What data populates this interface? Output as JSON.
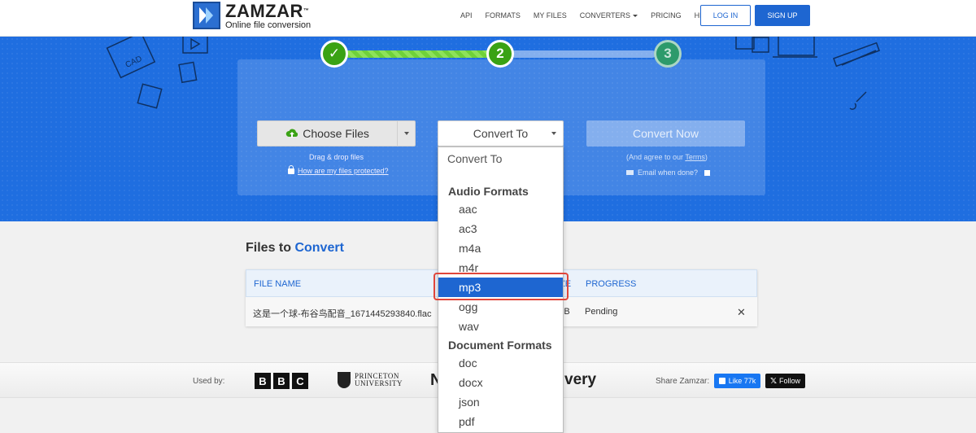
{
  "brand": {
    "name": "ZAMZAR",
    "tm": "™",
    "tagline": "Online file conversion"
  },
  "nav": {
    "links": [
      "API",
      "FORMATS",
      "MY FILES",
      "CONVERTERS",
      "PRICING",
      "HELP"
    ],
    "login": "LOG IN",
    "signup": "SIGN UP"
  },
  "steps": {
    "step1": "✓",
    "step2": "2",
    "step3": "3"
  },
  "upload": {
    "choose_files": "Choose Files",
    "drag_drop": "Drag & drop files",
    "protected_link": "How are my files protected?"
  },
  "convert_to": {
    "label": "Convert To"
  },
  "convert_now": {
    "label": "Convert Now",
    "terms_prefix": "(And agree to our ",
    "terms_link": "Terms",
    "terms_suffix": ")",
    "email_label": "Email when done?"
  },
  "dropdown": {
    "placeholder": "Convert To",
    "groups": [
      {
        "label": "Audio Formats",
        "options": [
          "aac",
          "ac3",
          "m4a",
          "m4r",
          "mp3",
          "ogg",
          "wav"
        ]
      },
      {
        "label": "Document Formats",
        "options": [
          "doc",
          "docx",
          "json",
          "pdf"
        ]
      }
    ],
    "selected": "mp3"
  },
  "files": {
    "title_prefix": "Files to ",
    "title_accent": "Convert",
    "headers": {
      "name": "FILE NAME",
      "size": "ZE",
      "progress": "PROGRESS"
    },
    "rows": [
      {
        "name": "这是一个球-布谷鸟配音_1671445293840.flac",
        "size": "KB",
        "progress": "Pending",
        "remove": "✕"
      }
    ]
  },
  "footer": {
    "used_by": "Used by:",
    "bbc": [
      "B",
      "B",
      "C"
    ],
    "princeton_line1": "PRINCETON",
    "princeton_line2": "UNIVERSITY",
    "partial_logo_1": "N",
    "partial_logo_2": "very",
    "share": "Share Zamzar:",
    "fb_like": "Like 77k",
    "x_follow": "Follow"
  },
  "colors": {
    "primary": "#1e66d1",
    "hero": "#1f6ee0",
    "success": "#3aa214",
    "highlight": "#e0463a"
  }
}
